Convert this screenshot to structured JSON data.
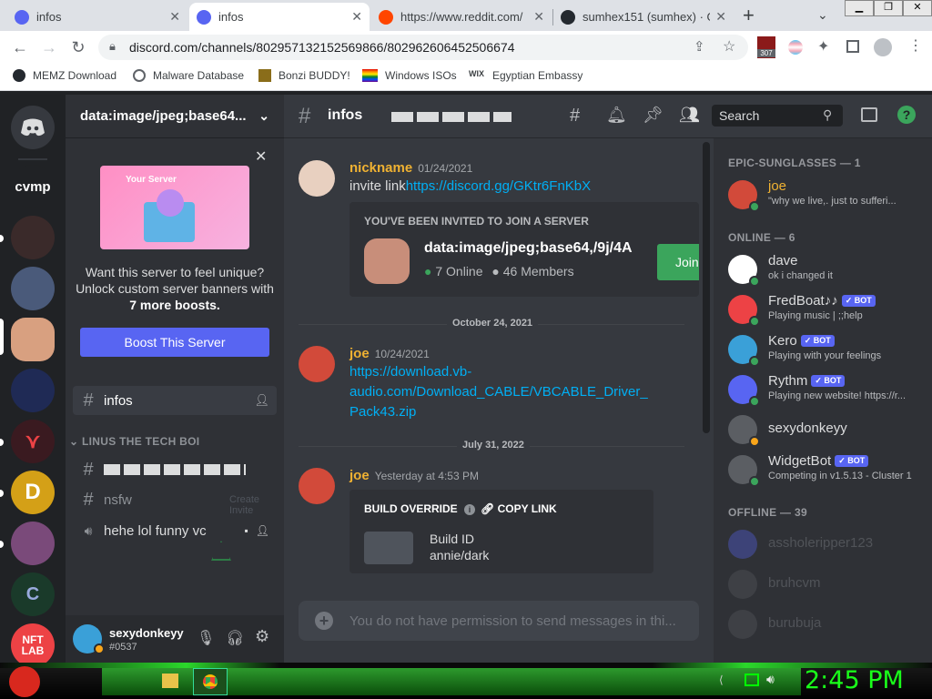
{
  "browser": {
    "tabs": [
      {
        "label": "infos",
        "icon": "discord-favicon"
      },
      {
        "label": "infos",
        "icon": "discord-favicon"
      },
      {
        "label": "https://www.reddit.com/",
        "icon": "reddit-favicon"
      },
      {
        "label": "sumhex151 (sumhex) · Gi",
        "icon": "github-favicon"
      }
    ],
    "new_tab": "+",
    "url": "discord.com/channels/802957132152569866/802962606452506674",
    "extension_badge": "307",
    "bookmarks": [
      {
        "label": "MEMZ Download",
        "icon": "github-icon"
      },
      {
        "label": "Malware Database",
        "icon": "globe-icon"
      },
      {
        "label": "Bonzi BUDDY!",
        "icon": "bonzi-icon"
      },
      {
        "label": "Windows ISOs",
        "icon": "rainbow-flag-icon"
      },
      {
        "label": "Egyptian Embassy",
        "icon": "wix-icon"
      }
    ]
  },
  "guilds": [
    {
      "label": "cvmp",
      "color": "#202225"
    },
    {
      "label": "",
      "color": "#3a2a2a"
    },
    {
      "label": "",
      "color": "#4a5a7a"
    },
    {
      "label": "",
      "color": "#d8a080"
    },
    {
      "label": "",
      "color": "#1f2a55"
    },
    {
      "label": "",
      "color": "#3a1a20"
    },
    {
      "label": "D",
      "color": "#d4a017"
    },
    {
      "label": "",
      "color": "#7a4a7a"
    },
    {
      "label": "C",
      "color": "#1a3a2a"
    },
    {
      "label": "NFT LAB",
      "color": "#ed4245"
    }
  ],
  "sidebar": {
    "server_name": "data:image/jpeg;base64...",
    "boost_card": {
      "banner_label": "Your Server",
      "line1": "Want this server to feel unique?",
      "line2": "Unlock custom server banners with",
      "line3": "7 more boosts.",
      "button": "Boost This Server"
    },
    "selected_channel": "infos",
    "category": "LINUS THE TECH BOI",
    "channels": [
      {
        "label": "",
        "type": "text"
      },
      {
        "label": "nsfw",
        "type": "text"
      },
      {
        "label": "hehe lol funny vc",
        "type": "voice"
      }
    ],
    "create_invite_hint": "Create Invite"
  },
  "user_panel": {
    "name": "sexydonkeyy",
    "tag": "#0537"
  },
  "chat": {
    "channel_name": "infos",
    "search_placeholder": "Search",
    "composer_placeholder": "You do not have permission to send messages in thi...",
    "messages": [
      {
        "author": "nickname",
        "timestamp": "01/24/2021",
        "text": "invite link",
        "link": "https://discord.gg/GKtr6FnKbX",
        "invite": {
          "heading": "YOU'VE BEEN INVITED TO JOIN A SERVER",
          "server": "data:image/jpeg;base64,/9j/4A",
          "online": "7 Online",
          "members": "46 Members",
          "join": "Join"
        }
      },
      {
        "divider": "October 24, 2021",
        "author": "joe",
        "timestamp": "10/24/2021",
        "link_lines": [
          "https://download.vb-",
          "audio.com/Download_CABLE/VBCABLE_Driver_",
          "Pack43.zip"
        ]
      },
      {
        "divider": "July 31, 2022",
        "author": "joe",
        "timestamp": "Yesterday at 4:53 PM",
        "embed": {
          "title": "BUILD OVERRIDE",
          "copy": "COPY LINK",
          "label": "Build ID",
          "value": "annie/dark"
        }
      }
    ]
  },
  "members": {
    "sections": [
      {
        "title": "EPIC-SUNGLASSES — 1",
        "items": [
          {
            "name": "joe",
            "sub": "\"why we live,. just to sufferi...",
            "status": "online",
            "bot": false,
            "color": "#f0b232"
          }
        ]
      },
      {
        "title": "ONLINE — 6",
        "items": [
          {
            "name": "dave",
            "sub": "ok i changed it",
            "status": "online",
            "bot": false,
            "color": "#dcddde"
          },
          {
            "name": "FredBoat♪♪",
            "sub": "Playing music | ;;help",
            "status": "online",
            "bot": true,
            "color": "#dcddde"
          },
          {
            "name": "Kero",
            "sub": "Playing with your feelings",
            "status": "online",
            "bot": true,
            "color": "#dcddde"
          },
          {
            "name": "Rythm",
            "sub": "Playing new website! https://r...",
            "status": "online",
            "bot": true,
            "color": "#dcddde"
          },
          {
            "name": "sexydonkeyy",
            "sub": "",
            "status": "idle",
            "bot": false,
            "color": "#dcddde"
          },
          {
            "name": "WidgetBot",
            "sub": "Competing in v1.5.13 - Cluster 1",
            "status": "online",
            "bot": true,
            "color": "#dcddde"
          }
        ]
      },
      {
        "title": "OFFLINE — 39",
        "items": [
          {
            "name": "assholeripper123",
            "sub": "",
            "status": "offline",
            "bot": false,
            "color": "#8e9297"
          },
          {
            "name": "bruhcvm",
            "sub": "",
            "status": "offline",
            "bot": false,
            "color": "#8e9297"
          },
          {
            "name": "burubuja",
            "sub": "",
            "status": "offline",
            "bot": false,
            "color": "#8e9297"
          }
        ]
      }
    ],
    "bot_label": "✓ BOT"
  },
  "taskbar": {
    "clock": "2:45 PM"
  }
}
